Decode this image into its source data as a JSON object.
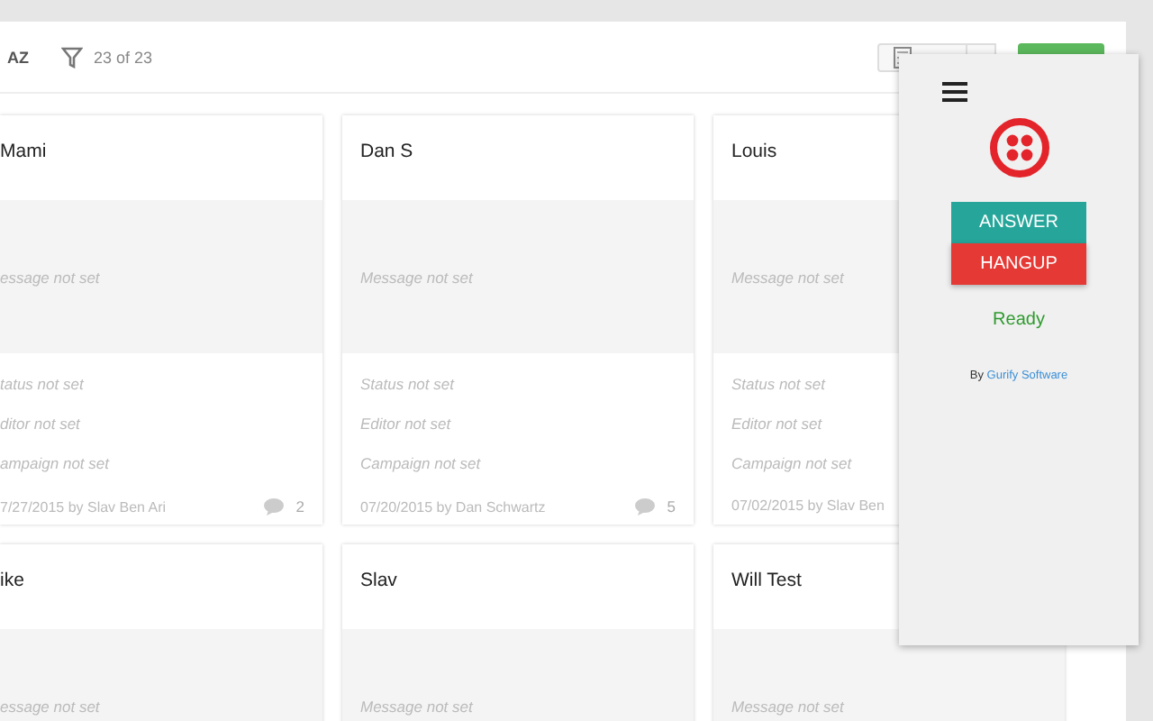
{
  "toolbar": {
    "sort_label": "AZ",
    "count": "23 of 23"
  },
  "cards": [
    {
      "name": "Mami",
      "message": "essage not set",
      "status": "tatus not set",
      "editor": "ditor not set",
      "campaign": "ampaign not set",
      "footer": "7/27/2015 by Slav Ben Ari",
      "comments": "2"
    },
    {
      "name": "Dan S",
      "message": "Message not set",
      "status": "Status not set",
      "editor": "Editor not set",
      "campaign": "Campaign not set",
      "footer": "07/20/2015 by Dan Schwartz",
      "comments": "5"
    },
    {
      "name": "Louis",
      "message": "Message not set",
      "status": "Status not set",
      "editor": "Editor not set",
      "campaign": "Campaign not set",
      "footer": "07/02/2015 by Slav Ben"
    },
    {
      "name": "ike",
      "message": "essage not set"
    },
    {
      "name": "Slav",
      "message": "Message not set"
    },
    {
      "name": "Will Test",
      "message": "Message not set"
    }
  ],
  "phone_panel": {
    "answer": "ANSWER",
    "hangup": "HANGUP",
    "status": "Ready",
    "credit_prefix": "By",
    "credit_link": "Gurify Software"
  }
}
